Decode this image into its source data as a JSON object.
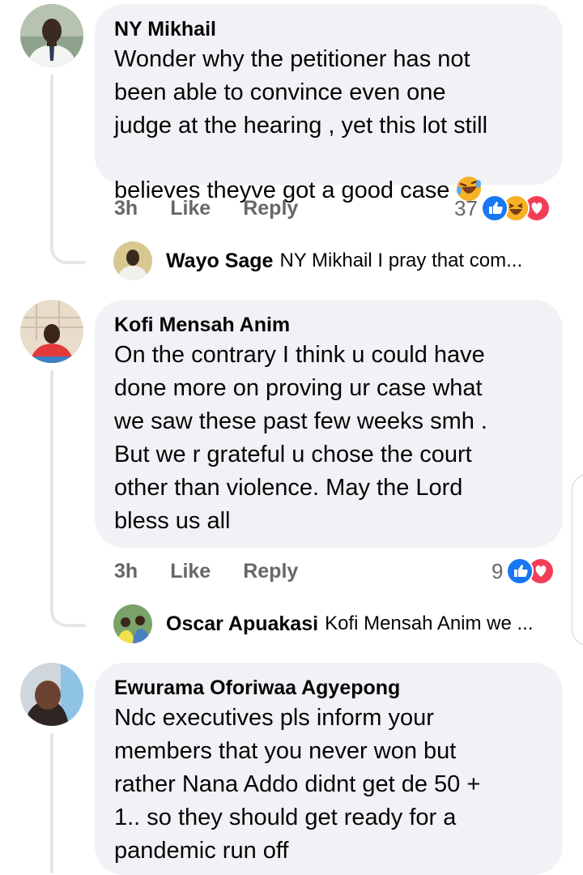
{
  "comments": [
    {
      "author": "NY Mikhail",
      "text": "Wonder why the petitioner has not\nbeen able to convince even one\njudge at the hearing , yet this lot still\nbelieves theyve got a good case",
      "emoji": "rolling-on-floor-laughing-emoji",
      "time": "3h",
      "like_label": "Like",
      "reply_label": "Reply",
      "reaction_count": "37",
      "reactions": [
        "like",
        "haha",
        "love"
      ],
      "reply_preview": {
        "author": "Wayo Sage",
        "text": "NY Mikhail I pray that com..."
      }
    },
    {
      "author": "Kofi Mensah Anim",
      "text": "On the contrary I think u could have\ndone more on proving ur case what\nwe saw these past few weeks smh .\nBut we r grateful u chose the court\nother than violence. May the Lord\nbless us all",
      "time": "3h",
      "like_label": "Like",
      "reply_label": "Reply",
      "reaction_count": "9",
      "reactions": [
        "like",
        "love"
      ],
      "reply_preview": {
        "author": "Oscar Apuakasi",
        "text": "Kofi Mensah Anim we ..."
      }
    },
    {
      "author": "Ewurama Oforiwaa Agyepong",
      "text": "Ndc executives pls inform your\nmembers  that you never won but\nrather Nana Addo didnt get de 50 +\n1.. so they should get ready for a\npandemic run off"
    }
  ],
  "colors": {
    "bubble": "#f0f2f5",
    "secondary_text": "#65676b",
    "like_blue": "#1877f2",
    "love_red": "#f33e58",
    "haha_yellow": "#f7b125",
    "thread_line": "#e4e6eb"
  }
}
